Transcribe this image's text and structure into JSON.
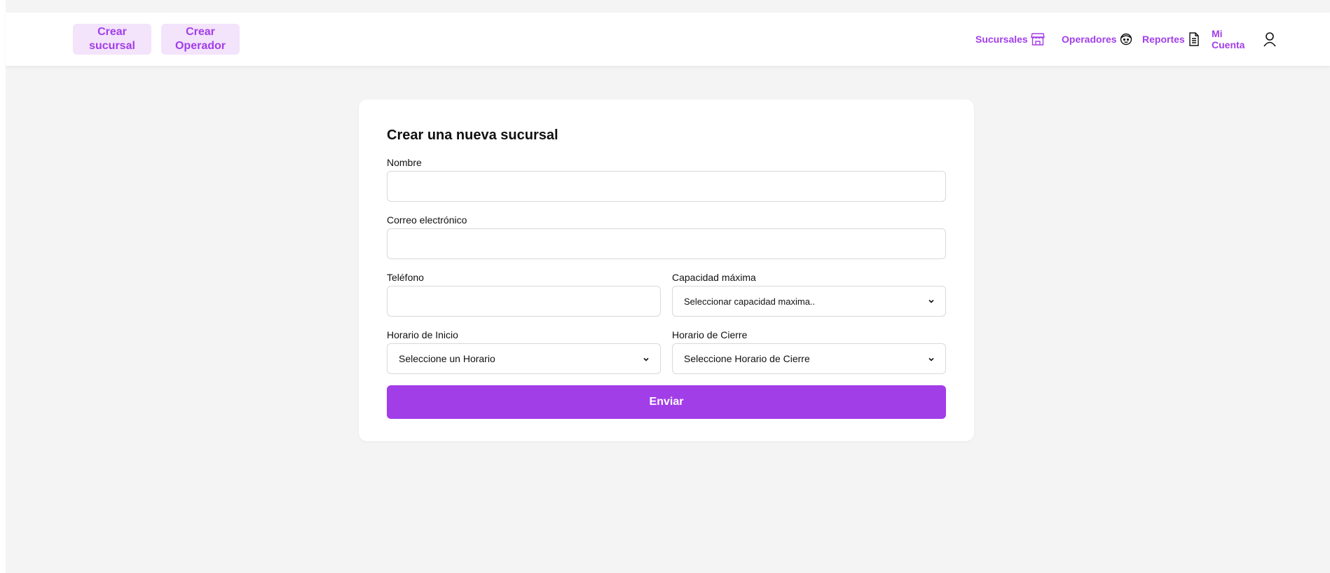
{
  "nav": {
    "create_branch_label": "Crear sucursal",
    "create_branch_line1": "Crear",
    "create_branch_line2": "sucursal",
    "create_operator_line1": "Crear",
    "create_operator_line2": "Operador",
    "links": {
      "branches": "Sucursales",
      "operators": "Operadores",
      "reports": "Reportes",
      "account_line1": "Mi",
      "account_line2": "Cuenta"
    },
    "icons": [
      "store-icon",
      "operator-face-icon",
      "document-icon",
      "user-icon"
    ]
  },
  "form": {
    "title": "Crear una nueva sucursal",
    "name_label": "Nombre",
    "name_value": "",
    "email_label": "Correo electrónico",
    "email_value": "",
    "phone_label": "Teléfono",
    "phone_value": "",
    "capacity_label": "Capacidad máxima",
    "capacity_selected": "Seleccionar capacidad maxima..",
    "start_label": "Horario de Inicio",
    "start_selected": "Seleccione un Horario",
    "close_label": "Horario de Cierre",
    "close_selected": "Seleccione Horario de Cierre",
    "submit_label": "Enviar"
  },
  "colors": {
    "accent": "#a23ee8",
    "pill_bg": "#f3e3fb",
    "page_bg": "#f4f4f4"
  }
}
